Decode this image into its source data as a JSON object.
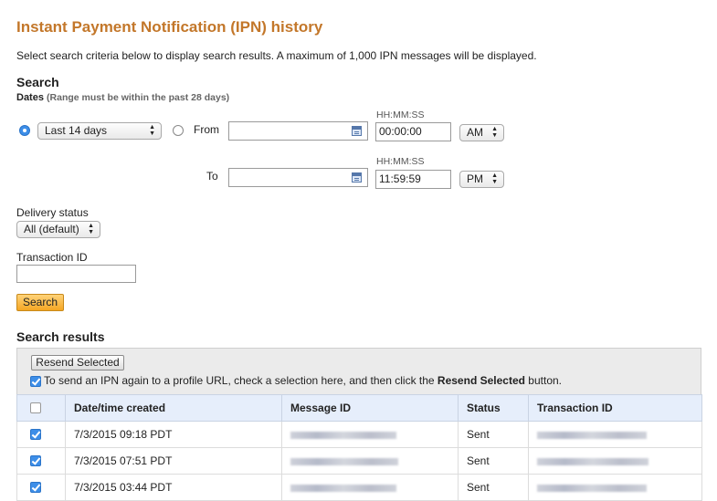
{
  "page": {
    "title": "Instant Payment Notification (IPN) history",
    "intro": "Select search criteria below to display search results. A maximum of 1,000 IPN messages will be displayed."
  },
  "search": {
    "heading": "Search",
    "dates_label": "Dates",
    "dates_hint": "(Range must be within the past 28 days)",
    "range_option": "Last 14 days",
    "from_label": "From",
    "to_label": "To",
    "time_format_label": "HH:MM:SS",
    "from_date": "",
    "from_time": "00:00:00",
    "from_ampm": "AM",
    "to_date": "",
    "to_time": "11:59:59",
    "to_ampm": "PM",
    "delivery_status_label": "Delivery status",
    "delivery_status_value": "All (default)",
    "transaction_id_label": "Transaction ID",
    "transaction_id_value": "",
    "button_label": "Search"
  },
  "results": {
    "heading": "Search results",
    "resend_button": "Resend Selected",
    "instructions_prefix": "To send an IPN again to a profile URL, check a selection here, and then click the ",
    "instructions_bold": "Resend Selected",
    "instructions_suffix": " button.",
    "columns": [
      "Date/time created",
      "Message ID",
      "Status",
      "Transaction ID"
    ],
    "rows": [
      {
        "date": "7/3/2015 09:18 PDT",
        "status": "Sent"
      },
      {
        "date": "7/3/2015 07:51 PDT",
        "status": "Sent"
      },
      {
        "date": "7/3/2015 03:44 PDT",
        "status": "Sent"
      }
    ]
  },
  "colors": {
    "title": "#c3772a",
    "accent": "#3d8ee8",
    "search_button": "#f5a623",
    "table_header": "#e6eefb"
  }
}
